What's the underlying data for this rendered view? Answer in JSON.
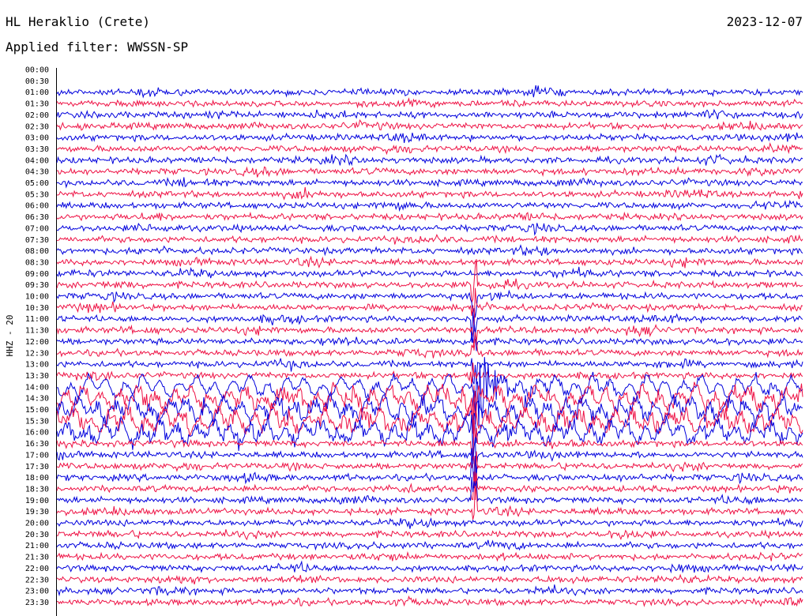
{
  "header": {
    "station": "HL Heraklio (Crete)",
    "date": "2023-12-07",
    "filter_label": "Applied filter: WWSSN-SP"
  },
  "chart_data": {
    "type": "line",
    "title": "HL Heraklio (Crete)",
    "subtitle": "Applied filter: WWSSN-SP",
    "ylabel": "HHZ - 20",
    "y_tick_labels": [
      "00:00",
      "00:30",
      "01:00",
      "01:30",
      "02:00",
      "02:30",
      "03:00",
      "03:30",
      "04:00",
      "04:30",
      "05:00",
      "05:30",
      "06:00",
      "06:30",
      "07:00",
      "07:30",
      "08:00",
      "08:30",
      "09:00",
      "09:30",
      "10:00",
      "10:30",
      "11:00",
      "11:30",
      "12:00",
      "12:30",
      "13:00",
      "13:30",
      "14:00",
      "14:30",
      "15:00",
      "15:30",
      "16:00",
      "16:30",
      "17:00",
      "17:30",
      "18:00",
      "18:30",
      "19:00",
      "19:30",
      "20:00",
      "20:30",
      "21:00",
      "21:30",
      "22:00",
      "22:30",
      "23:00",
      "23:30"
    ],
    "trace_colors": [
      "#0000dd",
      "#ee1144"
    ],
    "traces_start": "01:00",
    "event": {
      "onset_trace_row": "14:00",
      "onset_fraction_of_row": 0.56,
      "coda_trace_rows": [
        "14:00",
        "14:30",
        "15:00",
        "15:30",
        "16:00"
      ]
    },
    "grid": false,
    "legend": "none"
  }
}
